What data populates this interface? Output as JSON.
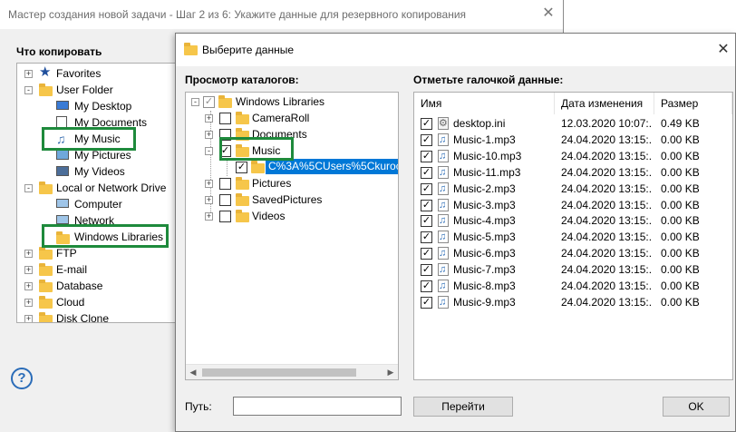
{
  "wizard": {
    "title": "Мастер создания новой задачи - Шаг 2 из 6: Укажите данные для резервного копирования",
    "section_label": "Что копировать",
    "source_tree": [
      {
        "label": "Favorites",
        "icon": "star-icon",
        "expander": "+"
      },
      {
        "label": "User Folder",
        "icon": "folder-icon",
        "expander": "-"
      },
      {
        "label": "My Desktop",
        "icon": "desktop-icon"
      },
      {
        "label": "My Documents",
        "icon": "documents-icon"
      },
      {
        "label": "My Music",
        "icon": "music-icon"
      },
      {
        "label": "My Pictures",
        "icon": "pictures-icon"
      },
      {
        "label": "My Videos",
        "icon": "videos-icon"
      },
      {
        "label": "Local or Network Drive",
        "icon": "folder-icon",
        "expander": "-"
      },
      {
        "label": "Computer",
        "icon": "computer-icon"
      },
      {
        "label": "Network",
        "icon": "network-icon"
      },
      {
        "label": "Windows Libraries",
        "icon": "library-icon"
      },
      {
        "label": "FTP",
        "icon": "folder-icon",
        "expander": "+"
      },
      {
        "label": "E-mail",
        "icon": "folder-icon",
        "expander": "+"
      },
      {
        "label": "Database",
        "icon": "folder-icon",
        "expander": "+"
      },
      {
        "label": "Cloud",
        "icon": "folder-icon",
        "expander": "+"
      },
      {
        "label": "Disk Clone",
        "icon": "folder-icon",
        "expander": "+"
      }
    ],
    "help_glyph": "?"
  },
  "dialog": {
    "title": "Выберите данные",
    "catalog_label": "Просмотр каталогов:",
    "files_label": "Отметьте галочкой данные:",
    "catalog_tree": [
      {
        "label": "Windows Libraries",
        "checked": "partial",
        "expander": "-"
      },
      {
        "label": "CameraRoll",
        "checked": "none",
        "expander": "+"
      },
      {
        "label": "Documents",
        "checked": "none",
        "expander": "+"
      },
      {
        "label": "Music",
        "checked": "full",
        "expander": "-"
      },
      {
        "label": "C%3A%5CUsers%5Ckuroc",
        "checked": "full",
        "selected": true
      },
      {
        "label": "Pictures",
        "checked": "none",
        "expander": "+"
      },
      {
        "label": "SavedPictures",
        "checked": "none",
        "expander": "+"
      },
      {
        "label": "Videos",
        "checked": "none",
        "expander": "+"
      }
    ],
    "columns": {
      "name": "Имя",
      "modified": "Дата изменения",
      "size": "Размер"
    },
    "files": [
      {
        "name": "desktop.ini",
        "modified": "12.03.2020 10:07:...",
        "size": "0.49 KB",
        "icon": "settings-file-icon"
      },
      {
        "name": "Music-1.mp3",
        "modified": "24.04.2020 13:15:...",
        "size": "0.00 KB",
        "icon": "music-file-icon"
      },
      {
        "name": "Music-10.mp3",
        "modified": "24.04.2020 13:15:...",
        "size": "0.00 KB",
        "icon": "music-file-icon"
      },
      {
        "name": "Music-11.mp3",
        "modified": "24.04.2020 13:15:...",
        "size": "0.00 KB",
        "icon": "music-file-icon"
      },
      {
        "name": "Music-2.mp3",
        "modified": "24.04.2020 13:15:...",
        "size": "0.00 KB",
        "icon": "music-file-icon"
      },
      {
        "name": "Music-3.mp3",
        "modified": "24.04.2020 13:15:...",
        "size": "0.00 KB",
        "icon": "music-file-icon"
      },
      {
        "name": "Music-4.mp3",
        "modified": "24.04.2020 13:15:...",
        "size": "0.00 KB",
        "icon": "music-file-icon"
      },
      {
        "name": "Music-5.mp3",
        "modified": "24.04.2020 13:15:...",
        "size": "0.00 KB",
        "icon": "music-file-icon"
      },
      {
        "name": "Music-6.mp3",
        "modified": "24.04.2020 13:15:...",
        "size": "0.00 KB",
        "icon": "music-file-icon"
      },
      {
        "name": "Music-7.mp3",
        "modified": "24.04.2020 13:15:...",
        "size": "0.00 KB",
        "icon": "music-file-icon"
      },
      {
        "name": "Music-8.mp3",
        "modified": "24.04.2020 13:15:...",
        "size": "0.00 KB",
        "icon": "music-file-icon"
      },
      {
        "name": "Music-9.mp3",
        "modified": "24.04.2020 13:15:...",
        "size": "0.00 KB",
        "icon": "music-file-icon"
      }
    ],
    "path_label": "Путь:",
    "path_value": "",
    "go_button": "Перейти",
    "ok_button": "OK"
  },
  "colors": {
    "highlight_green": "#1e8a3c",
    "selection_blue": "#0078d7",
    "folder_yellow": "#f6c64a"
  }
}
